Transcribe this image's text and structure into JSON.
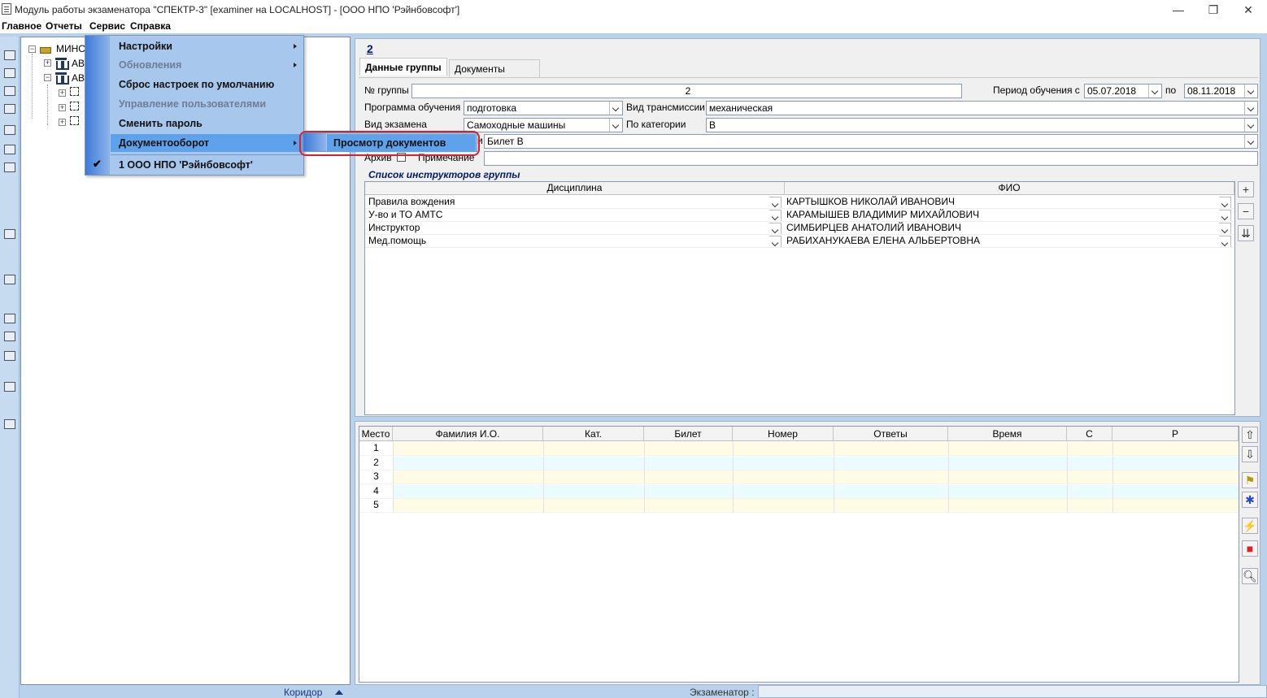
{
  "window": {
    "title": "Модуль работы экзаменатора \"СПЕКТР-3\" [examiner на LOCALHOST] - [ООО НПО 'Рэйнбовсофт']",
    "minimize": "—",
    "restore": "❐",
    "close": "✕"
  },
  "menubar": [
    "Главное",
    "Отчеты",
    "Сервис",
    "Справка"
  ],
  "service_menu": {
    "items": [
      {
        "label": "Настройки",
        "submenu": true,
        "disabled": false
      },
      {
        "label": "Обновления",
        "submenu": true,
        "disabled": true
      },
      {
        "label": "Сброс настроек по умолчанию",
        "submenu": false,
        "disabled": false
      },
      {
        "label": "Управление пользователями",
        "submenu": false,
        "disabled": true
      },
      {
        "label": "Сменить пароль",
        "submenu": false,
        "disabled": false
      },
      {
        "label": "Документооборот",
        "submenu": true,
        "disabled": false,
        "highlighted": true
      },
      {
        "label": "1 ООО НПО 'Рэйнбовсофт'",
        "submenu": false,
        "disabled": false,
        "checked": true
      }
    ],
    "submenu_docs": "Просмотр документов"
  },
  "tree": {
    "root": "МИНС",
    "children": [
      "АВ",
      "АВ"
    ]
  },
  "group": {
    "number_header": "2",
    "tabs": [
      "Данные группы",
      "Документы"
    ],
    "labels": {
      "group_no": "№ группы",
      "period": "Период обучения с",
      "period_to": "по",
      "program": "Программа обучения",
      "transmission": "Вид трансмиссии",
      "exam_type": "Вид экзамена",
      "category": "По категории",
      "ticket_suffix": "и",
      "archive": "Архив",
      "note": "Примечание",
      "instructors": "Список инструкторов группы"
    },
    "values": {
      "group_no": "2",
      "date_from": "05.07.2018",
      "date_to": "08.11.2018",
      "program": "подготовка",
      "transmission": "механическая",
      "exam_type": "Самоходные машины",
      "category": "В",
      "ticket": "Билет В",
      "note": ""
    }
  },
  "instructors_table": {
    "headers": [
      "Дисциплина",
      "ФИО"
    ],
    "rows": [
      {
        "discipline": "Правила вождения",
        "name": "КАРТЫШКОВ НИКОЛАЙ ИВАНОВИЧ"
      },
      {
        "discipline": "У-во и ТО АМТС",
        "name": "КАРАМЫШЕВ ВЛАДИМИР МИХАЙЛОВИЧ"
      },
      {
        "discipline": "Инструктор",
        "name": "СИМБИРЦЕВ АНАТОЛИЙ ИВАНОВИЧ"
      },
      {
        "discipline": "Мед.помощь",
        "name": "РАБИХАНУКАЕВА ЕЛЕНА АЛЬБЕРТОВНА"
      }
    ]
  },
  "places_table": {
    "headers": [
      "Место",
      "Фамилия И.О.",
      "Кат.",
      "Билет",
      "Номер",
      "Ответы",
      "Время",
      "С",
      "Р"
    ],
    "rows": [
      "1",
      "2",
      "3",
      "4",
      "5"
    ]
  },
  "status": {
    "corridor": "Коридор",
    "examiner": "Экзаменатор :"
  },
  "colors": {
    "background": "#b9d1ea",
    "menu_bg": "#a7c8ec",
    "menu_highlight": "#5fa2ec",
    "ring": "#d6232a",
    "row_yellow": "#fffbe4",
    "row_cyan": "#eafcff"
  }
}
